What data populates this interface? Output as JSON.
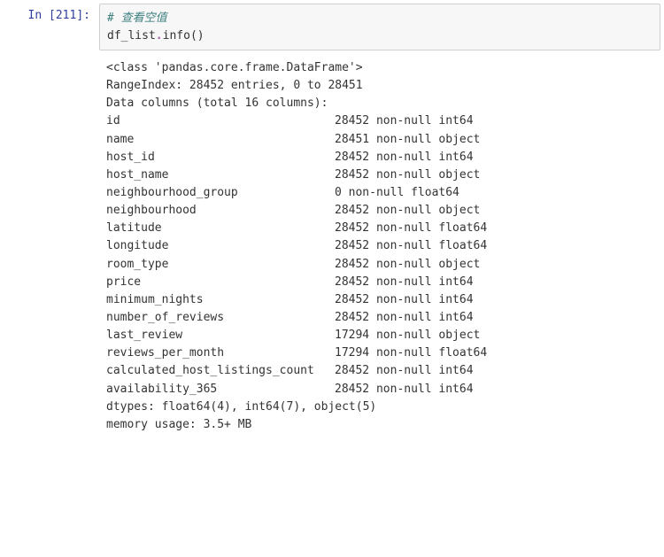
{
  "prompt": {
    "label": "In [211]:"
  },
  "code": {
    "comment": "# 查看空值",
    "stmt_obj": "df_list",
    "stmt_dot": ".",
    "stmt_method": "info",
    "stmt_parens": "()"
  },
  "output": {
    "class_line": "<class 'pandas.core.frame.DataFrame'>",
    "range_line": "RangeIndex: 28452 entries, 0 to 28451",
    "data_cols_line": "Data columns (total 16 columns):",
    "columns": [
      {
        "name": "id",
        "info": "28452 non-null int64"
      },
      {
        "name": "name",
        "info": "28451 non-null object"
      },
      {
        "name": "host_id",
        "info": "28452 non-null int64"
      },
      {
        "name": "host_name",
        "info": "28452 non-null object"
      },
      {
        "name": "neighbourhood_group",
        "info": "0 non-null float64"
      },
      {
        "name": "neighbourhood",
        "info": "28452 non-null object"
      },
      {
        "name": "latitude",
        "info": "28452 non-null float64"
      },
      {
        "name": "longitude",
        "info": "28452 non-null float64"
      },
      {
        "name": "room_type",
        "info": "28452 non-null object"
      },
      {
        "name": "price",
        "info": "28452 non-null int64"
      },
      {
        "name": "minimum_nights",
        "info": "28452 non-null int64"
      },
      {
        "name": "number_of_reviews",
        "info": "28452 non-null int64"
      },
      {
        "name": "last_review",
        "info": "17294 non-null object"
      },
      {
        "name": "reviews_per_month",
        "info": "17294 non-null float64"
      },
      {
        "name": "calculated_host_listings_count",
        "info": "28452 non-null int64"
      },
      {
        "name": "availability_365",
        "info": "28452 non-null int64"
      }
    ],
    "dtypes_line": "dtypes: float64(4), int64(7), object(5)",
    "memory_line": "memory usage: 3.5+ MB"
  }
}
